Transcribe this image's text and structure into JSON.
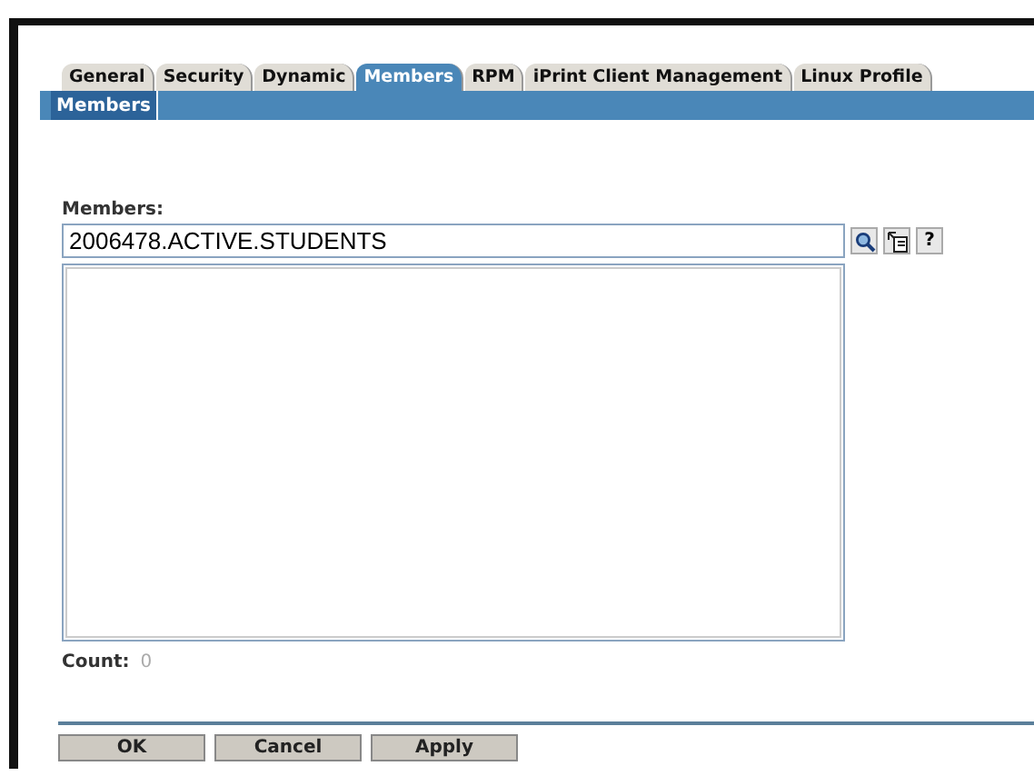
{
  "tabs": [
    {
      "label": "General",
      "selected": false
    },
    {
      "label": "Security",
      "selected": false
    },
    {
      "label": "Dynamic",
      "selected": false
    },
    {
      "label": "Members",
      "selected": true
    },
    {
      "label": "RPM",
      "selected": false
    },
    {
      "label": "iPrint Client Management",
      "selected": false
    },
    {
      "label": "Linux Profile",
      "selected": false
    }
  ],
  "subtabs": [
    {
      "label": "Members",
      "selected": true
    }
  ],
  "members": {
    "label": "Members:",
    "value": "2006478.ACTIVE.STUDENTS",
    "help_button": "?"
  },
  "count": {
    "label": "Count:",
    "value": "0"
  },
  "buttons": [
    "OK",
    "Cancel",
    "Apply"
  ]
}
